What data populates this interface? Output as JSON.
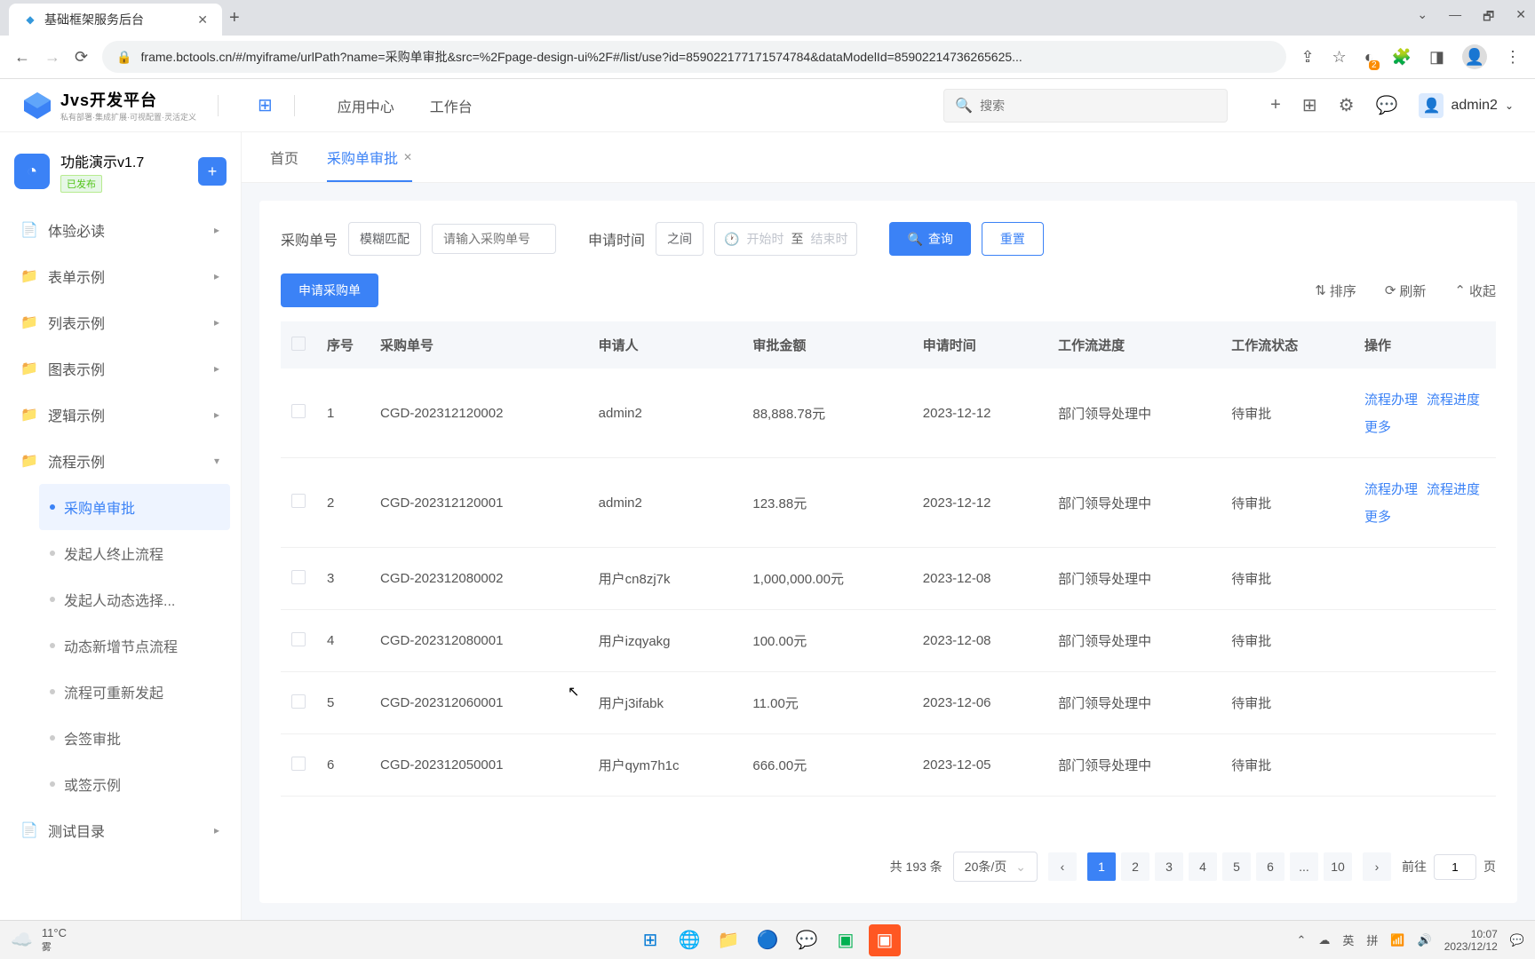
{
  "browser": {
    "tab_title": "基础框架服务后台",
    "url": "frame.bctools.cn/#/myiframe/urlPath?name=采购单审批&src=%2Fpage-design-ui%2F#/list/use?id=859022177171574784&dataModelId=85902214736265625...",
    "win_restore": "🗗"
  },
  "header": {
    "logo_title": "Jvs开发平台",
    "logo_sub": "私有部署·集成扩展·可视配置·灵活定义",
    "nav_appcenter": "应用中心",
    "nav_workbench": "工作台",
    "search_placeholder": "搜索",
    "username": "admin2"
  },
  "sidebar": {
    "title": "功能演示v1.7",
    "status_tag": "已发布",
    "menu": [
      {
        "label": "体验必读"
      },
      {
        "label": "表单示例"
      },
      {
        "label": "列表示例"
      },
      {
        "label": "图表示例"
      },
      {
        "label": "逻辑示例"
      },
      {
        "label": "流程示例"
      }
    ],
    "submenu": [
      {
        "label": "采购单审批",
        "active": true
      },
      {
        "label": "发起人终止流程"
      },
      {
        "label": "发起人动态选择..."
      },
      {
        "label": "动态新增节点流程"
      },
      {
        "label": "流程可重新发起"
      },
      {
        "label": "会签审批"
      },
      {
        "label": "或签示例"
      }
    ],
    "menu_test": "测试目录"
  },
  "tabs": {
    "home": "首页",
    "current": "采购单审批"
  },
  "filters": {
    "field1_label": "采购单号",
    "match_type": "模糊匹配",
    "field1_placeholder": "请输入采购单号",
    "field2_label": "申请时间",
    "between": "之间",
    "start_placeholder": "开始时",
    "to": "至",
    "end_placeholder": "结束时",
    "btn_query": "查询",
    "btn_reset": "重置"
  },
  "toolbar": {
    "btn_create": "申请采购单",
    "sort": "排序",
    "refresh": "刷新",
    "collapse": "收起"
  },
  "table": {
    "columns": {
      "seq": "序号",
      "order_no": "采购单号",
      "applicant": "申请人",
      "amount": "审批金额",
      "apply_time": "申请时间",
      "progress": "工作流进度",
      "status": "工作流状态",
      "action": "操作"
    },
    "rows": [
      {
        "seq": "1",
        "order_no": "CGD-202312120002",
        "applicant": "admin2",
        "amount": "88,888.78元",
        "apply_time": "2023-12-12",
        "progress": "部门领导处理中",
        "status": "待审批",
        "actions": true
      },
      {
        "seq": "2",
        "order_no": "CGD-202312120001",
        "applicant": "admin2",
        "amount": "123.88元",
        "apply_time": "2023-12-12",
        "progress": "部门领导处理中",
        "status": "待审批",
        "actions": true
      },
      {
        "seq": "3",
        "order_no": "CGD-202312080002",
        "applicant": "用户cn8zj7k",
        "amount": "1,000,000.00元",
        "apply_time": "2023-12-08",
        "progress": "部门领导处理中",
        "status": "待审批"
      },
      {
        "seq": "4",
        "order_no": "CGD-202312080001",
        "applicant": "用户izqyakg",
        "amount": "100.00元",
        "apply_time": "2023-12-08",
        "progress": "部门领导处理中",
        "status": "待审批"
      },
      {
        "seq": "5",
        "order_no": "CGD-202312060001",
        "applicant": "用户j3ifabk",
        "amount": "11.00元",
        "apply_time": "2023-12-06",
        "progress": "部门领导处理中",
        "status": "待审批"
      },
      {
        "seq": "6",
        "order_no": "CGD-202312050001",
        "applicant": "用户qym7h1c",
        "amount": "666.00元",
        "apply_time": "2023-12-05",
        "progress": "部门领导处理中",
        "status": "待审批"
      }
    ],
    "actions": {
      "process": "流程办理",
      "progress": "流程进度",
      "more": "更多"
    }
  },
  "pagination": {
    "total": "共 193 条",
    "page_size": "20条/页",
    "pages": [
      "1",
      "2",
      "3",
      "4",
      "5",
      "6",
      "...",
      "10"
    ],
    "jump_prefix": "前往",
    "jump_value": "1",
    "jump_suffix": "页"
  },
  "taskbar": {
    "temp": "11°C",
    "weather": "雾",
    "ime": "英",
    "ime_full": "拼",
    "time": "10:07",
    "date": "2023/12/12"
  }
}
